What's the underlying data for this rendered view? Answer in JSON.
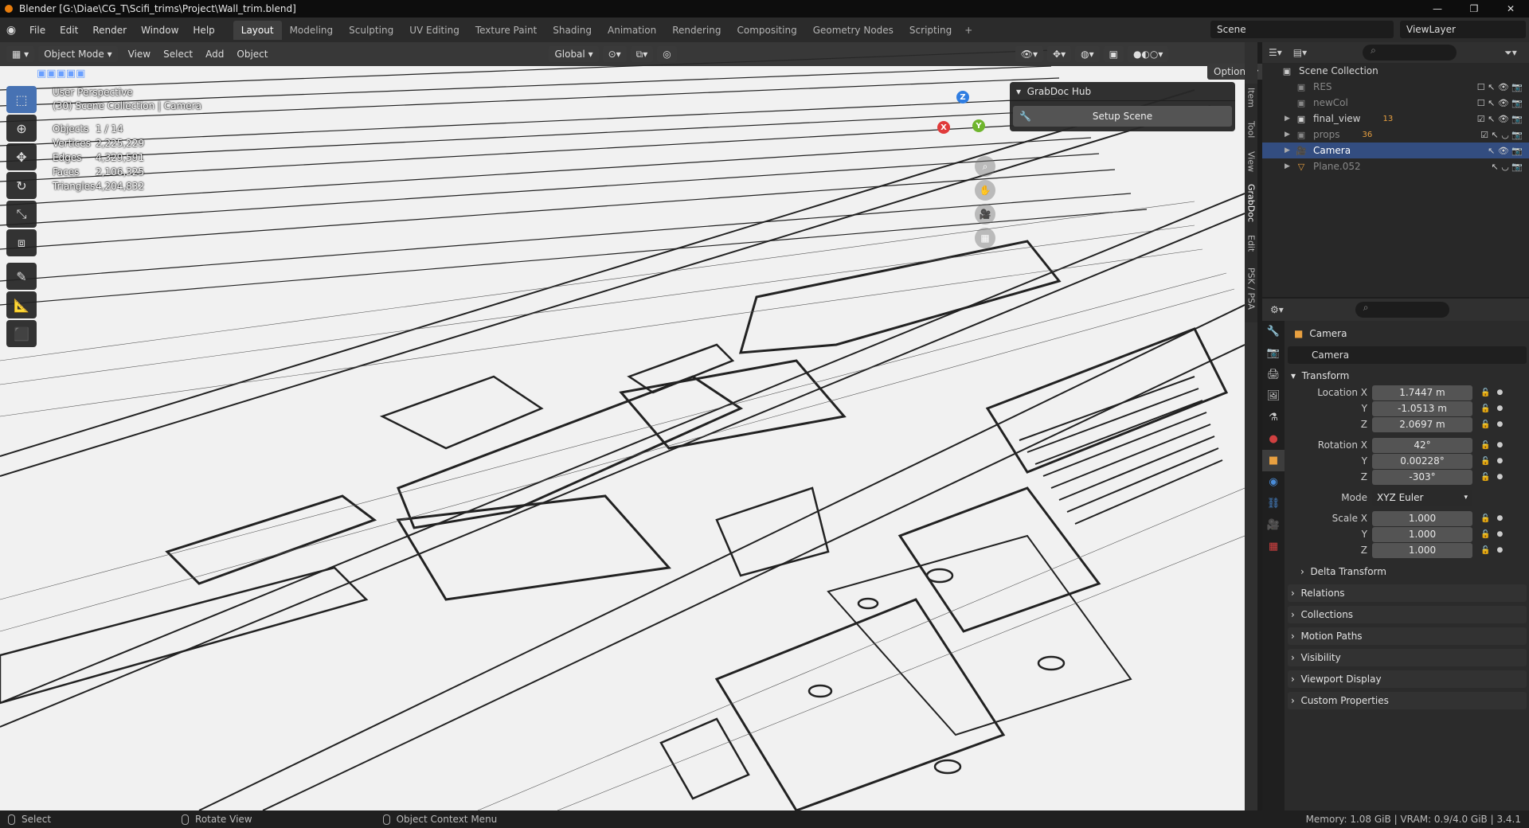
{
  "window": {
    "title": "Blender [G:\\Diae\\CG_T\\Scifi_trims\\Project\\Wall_trim.blend]",
    "min": "—",
    "max": "❐",
    "close": "✕"
  },
  "menubar": {
    "items": [
      "File",
      "Edit",
      "Render",
      "Window",
      "Help"
    ]
  },
  "workspaces": {
    "items": [
      "Layout",
      "Modeling",
      "Sculpting",
      "UV Editing",
      "Texture Paint",
      "Shading",
      "Animation",
      "Rendering",
      "Compositing",
      "Geometry Nodes",
      "Scripting"
    ],
    "active": "Layout",
    "add": "+"
  },
  "scene": {
    "name": "Scene",
    "viewlayer": "ViewLayer"
  },
  "viewport": {
    "mode": "Object Mode",
    "menus": [
      "View",
      "Select",
      "Add",
      "Object"
    ],
    "orientation": "Global",
    "options": "Options",
    "overlay": {
      "line1": "User Perspective",
      "line2": "(30) Scene Collection | Camera"
    },
    "stats": [
      {
        "k": "Objects",
        "v": "1 / 14"
      },
      {
        "k": "Vertices",
        "v": "2,225,229"
      },
      {
        "k": "Edges",
        "v": "4,329,591"
      },
      {
        "k": "Faces",
        "v": "2,106,325"
      },
      {
        "k": "Triangles",
        "v": "4,204,832"
      }
    ],
    "gizmo": {
      "x": "X",
      "y": "Y",
      "z": "Z"
    }
  },
  "grabdoc": {
    "title": "GrabDoc Hub",
    "button": "Setup Scene"
  },
  "sidetabs": [
    "Item",
    "Tool",
    "View",
    "GrabDoc",
    "Edit",
    "PSK / PSA"
  ],
  "outliner": {
    "root": "Scene Collection",
    "rows": [
      {
        "name": "RES",
        "type": "collection",
        "muted": true
      },
      {
        "name": "newCol",
        "type": "collection",
        "muted": true
      },
      {
        "name": "final_view",
        "type": "collection",
        "muted": false,
        "badge": "13"
      },
      {
        "name": "props",
        "type": "collection",
        "muted": true,
        "badge": "36"
      },
      {
        "name": "Camera",
        "type": "object",
        "muted": false,
        "selected": true
      },
      {
        "name": "Plane.052",
        "type": "mesh",
        "muted": true
      }
    ]
  },
  "properties": {
    "object_name": "Camera",
    "object_field": "Camera",
    "transform_label": "Transform",
    "location_label": "Location X",
    "location": [
      "1.7447 m",
      "-1.0513 m",
      "2.0697 m"
    ],
    "rotation_label": "Rotation X",
    "rotation": [
      "42°",
      "0.00228°",
      "-303°"
    ],
    "mode_label": "Mode",
    "mode": "XYZ Euler",
    "scale_label": "Scale X",
    "scale": [
      "1.000",
      "1.000",
      "1.000"
    ],
    "y_label": "Y",
    "z_label": "Z",
    "delta": "Delta Transform",
    "sections": [
      "Relations",
      "Collections",
      "Motion Paths",
      "Visibility",
      "Viewport Display",
      "Custom Properties"
    ]
  },
  "statusbar": {
    "select": "Select",
    "rotate": "Rotate View",
    "context": "Object Context Menu",
    "memory": "Memory: 1.08 GiB | VRAM: 0.9/4.0 GiB | 3.4.1"
  },
  "colors": {
    "accent": "#4772b3",
    "selection": "#334d80",
    "brand": "#e87d0d"
  }
}
